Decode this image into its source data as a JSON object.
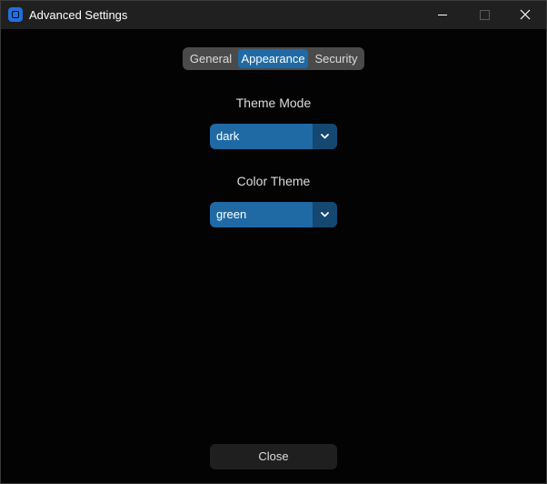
{
  "window": {
    "title": "Advanced Settings",
    "icon": "app-icon",
    "controls": [
      "minimize-icon",
      "maximize-icon",
      "close-icon"
    ]
  },
  "tabs": {
    "items": [
      {
        "label": "General",
        "active": false
      },
      {
        "label": "Appearance",
        "active": true
      },
      {
        "label": "Security",
        "active": false
      }
    ]
  },
  "appearance": {
    "theme_mode": {
      "label": "Theme Mode",
      "value": "dark"
    },
    "color_theme": {
      "label": "Color Theme",
      "value": "green"
    }
  },
  "footer": {
    "close_label": "Close"
  },
  "colors": {
    "accent": "#1f6aa5",
    "accent_dark": "#144870",
    "background": "#030304",
    "titlebar": "#202020",
    "tabbar": "#4a4a4a",
    "button": "#1f1f1f"
  }
}
